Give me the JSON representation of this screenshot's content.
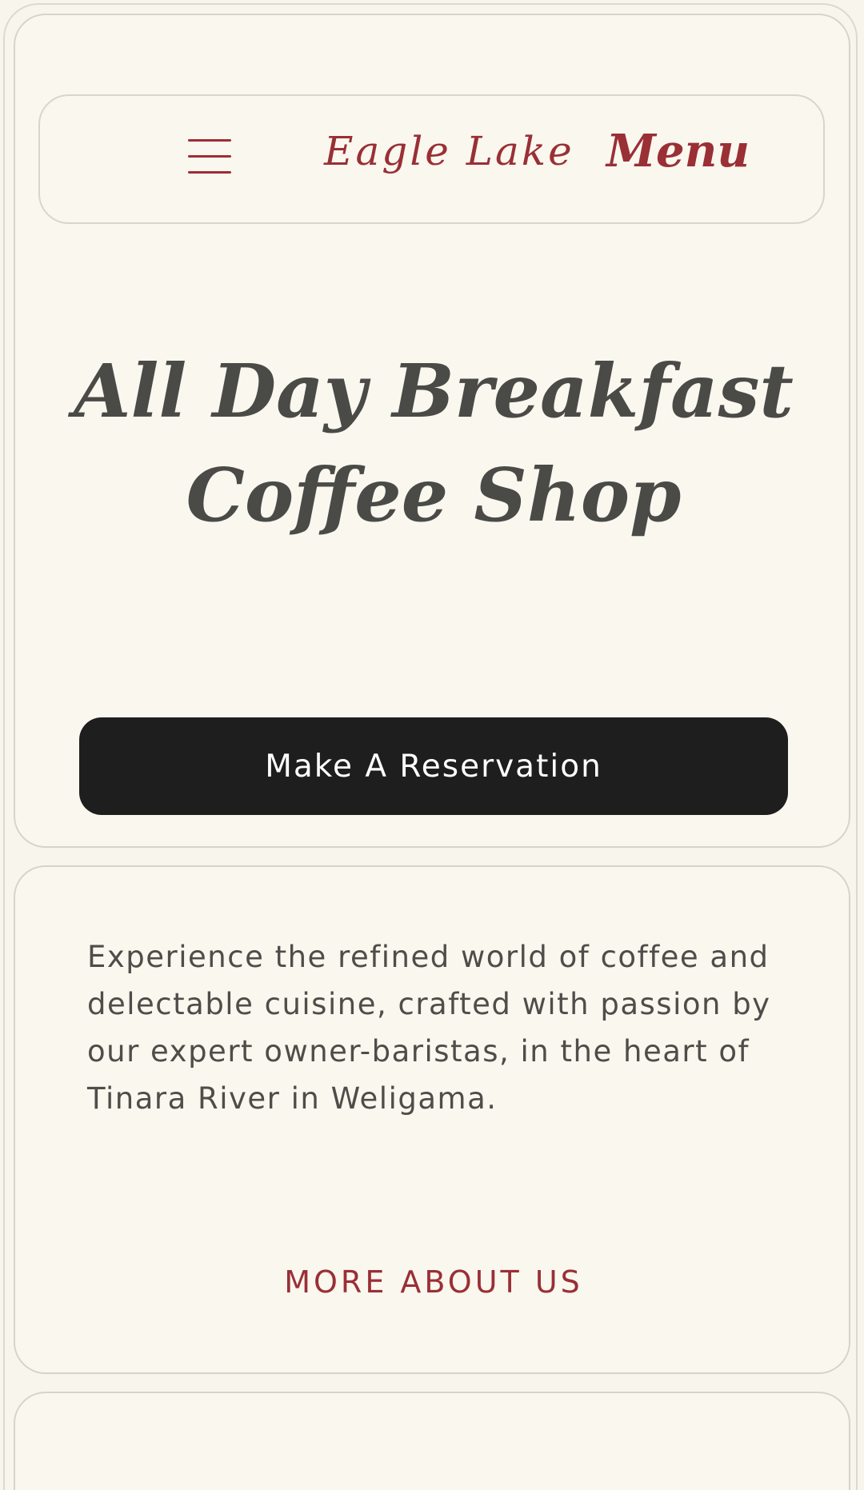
{
  "nav": {
    "brand": "Eagle Lake",
    "menu_label": "Menu"
  },
  "hero": {
    "title_line1": "All Day Breakfast",
    "title_line2": "Coffee Shop",
    "reserve_label": "Make A Reservation"
  },
  "about": {
    "text": "Experience the refined world of coffee and delectable cuisine, crafted with passion by our expert owner-baristas, in the heart of Tinara River in Weligama.",
    "link_label": "MORE ABOUT US"
  },
  "colors": {
    "accent": "#9a2f36",
    "background": "#f8f6ec",
    "button": "#1e1e1e",
    "heading": "#4a4a47"
  }
}
